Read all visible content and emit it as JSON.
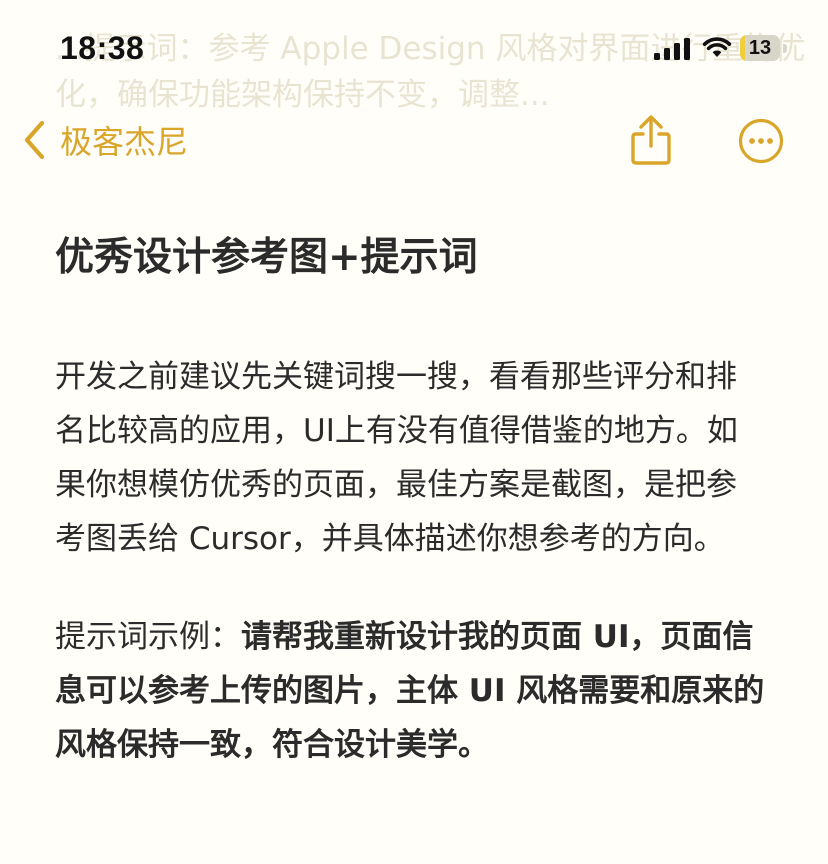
{
  "status_bar": {
    "time": "18:38",
    "battery_level": "13",
    "battery_fraction": 0.13
  },
  "background_ghost_text": "...提示词：参考 Apple Design 风格对界面进行重构优化，确保功能架构保持不变，调整...",
  "nav": {
    "back_label": "极客杰尼",
    "accent_color": "#d9a52a"
  },
  "note": {
    "title": "优秀设计参考图+提示词",
    "paragraph": "开发之前建议先关键词搜一搜，看看那些评分和排名比较高的应用，UI上有没有值得借鉴的地方。如果你想模仿优秀的页面，最佳方案是截图，是把参考图丢给 Cursor，并具体描述你想参考的方向。",
    "prompt_label": "提示词示例：",
    "prompt_text": "请帮我重新设计我的页面 UI，页面信息可以参考上传的图片，主体 UI 风格需要和原来的风格保持一致，符合设计美学。"
  },
  "icons": [
    "chevron-left-icon",
    "share-icon",
    "more-icon",
    "signal-icon",
    "wifi-icon",
    "battery-icon"
  ]
}
